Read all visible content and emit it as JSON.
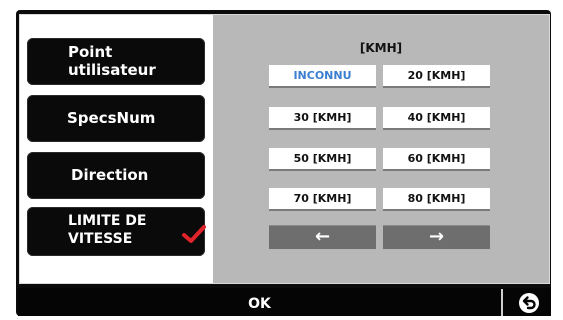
{
  "menu": {
    "items": [
      {
        "label": "Point\nutilisateur"
      },
      {
        "label": "SpecsNum"
      },
      {
        "label": "Direction"
      },
      {
        "label": "LIMITE DE\nVITESSE",
        "checked": true
      }
    ]
  },
  "speed_panel": {
    "unit_label": "[KMH]",
    "selected": "INCONNU",
    "options": [
      "INCONNU",
      "20 [KMH]",
      "30 [KMH]",
      "40 [KMH]",
      "50 [KMH]",
      "60 [KMH]",
      "70 [KMH]",
      "80 [KMH]"
    ],
    "prev_arrow": "←",
    "next_arrow": "→"
  },
  "footer": {
    "ok_label": "OK",
    "back_icon": "back-arrow-icon"
  },
  "colors": {
    "panel_bg": "#b8b8b8",
    "selected_text": "#3a7fd0",
    "check_red": "#e0242a",
    "frame": "#0b0b0b"
  }
}
